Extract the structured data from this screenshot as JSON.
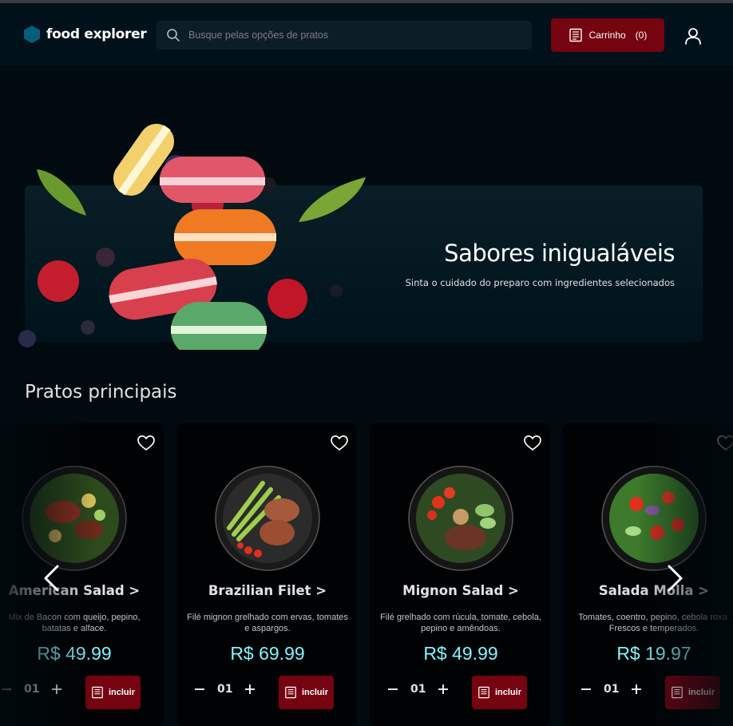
{
  "header": {
    "brand_name": "food explorer",
    "search_placeholder": "Busque pelas opções de pratos",
    "cart_label": "Carrinho",
    "cart_count": "(0)"
  },
  "banner": {
    "title": "Sabores inigualáveis",
    "subtitle": "Sinta o cuidado do preparo com ingredientes selecionados"
  },
  "section": {
    "title": "Pratos principais"
  },
  "cards": [
    {
      "name": "American Salad >",
      "description": "Mix de Bacon com queijo, pepino, batatas e alface.",
      "price": "R$ 49.99",
      "quantity": "01",
      "add_label": "incluir"
    },
    {
      "name": "Brazilian Filet >",
      "description": "Filé mignon grelhado com ervas, tomates e aspargos.",
      "price": "R$ 69.99",
      "quantity": "01",
      "add_label": "incluir"
    },
    {
      "name": "Mignon Salad >",
      "description": "Filé grelhado com rúcula, tomate, cebola, pepino e amêndoas.",
      "price": "R$ 49.99",
      "quantity": "01",
      "add_label": "incluir"
    },
    {
      "name": "Salada Molla >",
      "description": "Tomates, coentro, pepino, cebola roxa. Frescos e temperados.",
      "price": "R$ 19.97",
      "quantity": "01",
      "add_label": "incluir"
    }
  ],
  "colors": {
    "background": "#000a0f",
    "header": "#00111a",
    "accent_red": "#750310",
    "price": "#82f3ff",
    "brand_hex": "#065e7c"
  },
  "icons": {
    "brand": "hexagon-icon",
    "search": "search-icon",
    "cart": "receipt-icon",
    "user": "user-icon",
    "favorite": "heart-icon",
    "prev": "chevron-left-icon",
    "next": "chevron-right-icon",
    "minus": "minus-icon",
    "plus": "plus-icon"
  }
}
